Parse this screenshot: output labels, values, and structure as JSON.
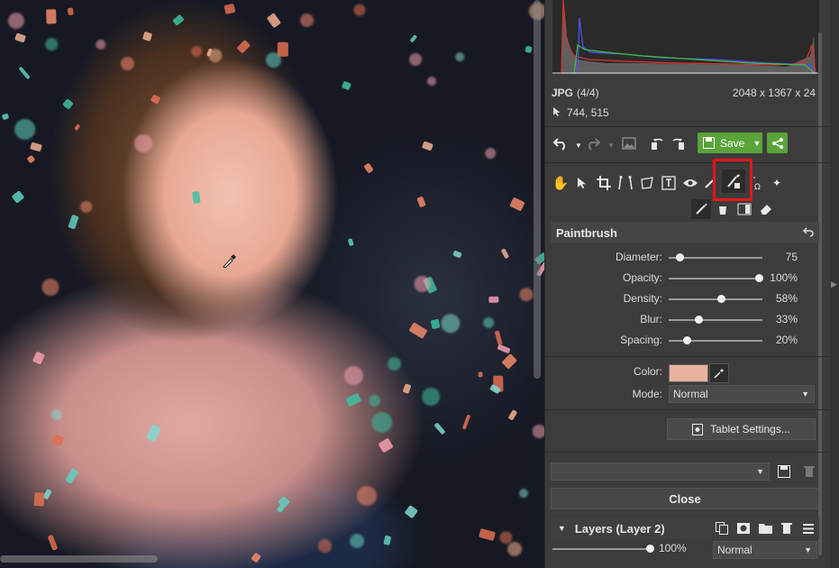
{
  "file": {
    "format": "JPG",
    "index": "(4/4)",
    "dimensions": "2048 x 1367 x 24",
    "cursor_coords": "744, 515"
  },
  "toolbar": {
    "save_label": "Save"
  },
  "tool_icons": [
    "hand-icon",
    "select-arrow-icon",
    "crop-icon",
    "perspective-icon",
    "transform-icon",
    "text-icon",
    "eye-icon",
    "brush-mask-icon",
    "gradient-icon",
    "lasso-icon",
    "magic-icon"
  ],
  "paintbrush": {
    "title": "Paintbrush",
    "sliders": [
      {
        "label": "Diameter:",
        "value": "75",
        "fraction": 0.12
      },
      {
        "label": "Opacity:",
        "value": "100%",
        "fraction": 1.0
      },
      {
        "label": "Density:",
        "value": "58%",
        "fraction": 0.58
      },
      {
        "label": "Blur:",
        "value": "33%",
        "fraction": 0.33
      },
      {
        "label": "Spacing:",
        "value": "20%",
        "fraction": 0.2
      }
    ],
    "color_label": "Color:",
    "color_value": "#e8b2a0",
    "mode_label": "Mode:",
    "mode_value": "Normal",
    "tablet_settings_label": "Tablet Settings..."
  },
  "preset": {
    "value": ""
  },
  "close_label": "Close",
  "layers": {
    "title": "Layers (Layer 2)",
    "opacity_value": "100%",
    "opacity_fraction": 1.0,
    "mode_value": "Normal"
  },
  "colors": {
    "accent_green": "#5aa43a",
    "highlight_red": "#e8141b"
  }
}
